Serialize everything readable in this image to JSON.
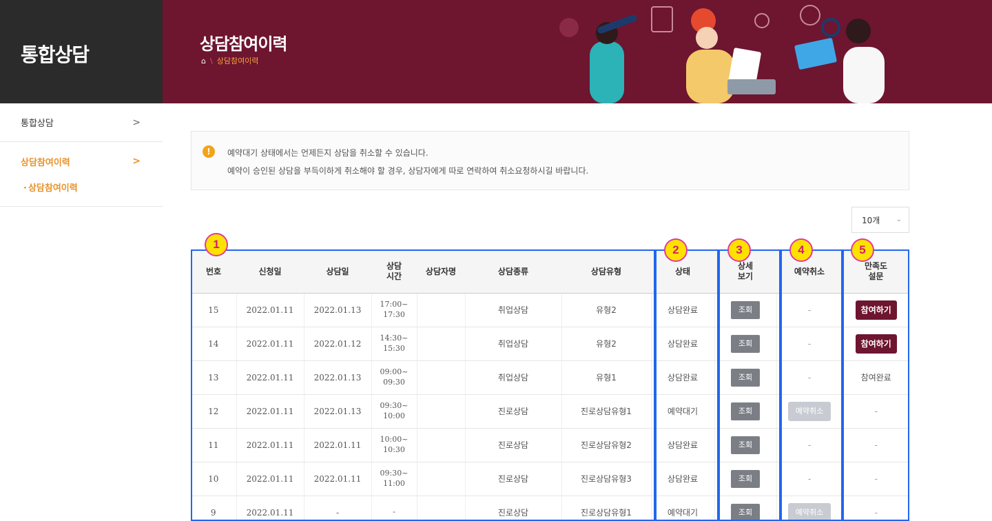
{
  "sidebar": {
    "brand": "통합상담",
    "items": [
      {
        "label": "통합상담",
        "chevron": ">"
      },
      {
        "label": "상담참여이력",
        "chevron": ">"
      }
    ],
    "sub_item": "상담참여이력"
  },
  "banner": {
    "title": "상담참여이력",
    "breadcrumb_current": "상담참여이력",
    "home_icon": "home-icon"
  },
  "notice": {
    "icon": "!",
    "line1": "예약대기 상태에서는 언제든지 상담을 취소할 수 있습니다.",
    "line2": "예약이 승인된 상담을 부득이하게 취소해야 할 경우, 상담자에게 따로 연락하여 취소요청하시길 바랍니다."
  },
  "page_size": {
    "value": "10개",
    "caret": "⌄"
  },
  "table": {
    "headers": {
      "no": "번호",
      "apply_date": "신청일",
      "counsel_date": "상담일",
      "time_l1": "상담",
      "time_l2": "시간",
      "counselor": "상담자명",
      "kind": "상담종류",
      "type": "상담유형",
      "status": "상태",
      "detail_l1": "상세",
      "detail_l2": "보기",
      "cancel": "예약취소",
      "survey_l1": "만족도",
      "survey_l2": "설문"
    },
    "rows": [
      {
        "no": "15",
        "apply": "2022.01.11",
        "date": "2022.01.13",
        "t1": "17:00~",
        "t2": "17:30",
        "counselor": "",
        "kind": "취업상담",
        "type": "유형2",
        "status": "상담완료",
        "view": "조회",
        "cancel": "-",
        "survey": "참여하기",
        "survey_mode": "button"
      },
      {
        "no": "14",
        "apply": "2022.01.11",
        "date": "2022.01.12",
        "t1": "14:30~",
        "t2": "15:30",
        "counselor": "",
        "kind": "취업상담",
        "type": "유형2",
        "status": "상담완료",
        "view": "조회",
        "cancel": "-",
        "survey": "참여하기",
        "survey_mode": "button"
      },
      {
        "no": "13",
        "apply": "2022.01.11",
        "date": "2022.01.13",
        "t1": "09:00~",
        "t2": "09:30",
        "counselor": "",
        "kind": "취업상담",
        "type": "유형1",
        "status": "상담완료",
        "view": "조회",
        "cancel": "-",
        "survey": "참여완료",
        "survey_mode": "text"
      },
      {
        "no": "12",
        "apply": "2022.01.11",
        "date": "2022.01.13",
        "t1": "09:30~",
        "t2": "10:00",
        "counselor": "",
        "kind": "진로상담",
        "type": "진로상담유형1",
        "status": "예약대기",
        "view": "조회",
        "cancel": "예약취소",
        "survey": "-",
        "survey_mode": "text"
      },
      {
        "no": "11",
        "apply": "2022.01.11",
        "date": "2022.01.11",
        "t1": "10:00~",
        "t2": "10:30",
        "counselor": "",
        "kind": "진로상담",
        "type": "진로상담유형2",
        "status": "상담완료",
        "view": "조회",
        "cancel": "-",
        "survey": "-",
        "survey_mode": "text"
      },
      {
        "no": "10",
        "apply": "2022.01.11",
        "date": "2022.01.11",
        "t1": "09:30~",
        "t2": "11:00",
        "counselor": "",
        "kind": "진로상담",
        "type": "진로상담유형3",
        "status": "상담완료",
        "view": "조회",
        "cancel": "-",
        "survey": "-",
        "survey_mode": "text"
      },
      {
        "no": "9",
        "apply": "2022.01.11",
        "date": "-",
        "t1": "-",
        "t2": "",
        "counselor": "",
        "kind": "진로상담",
        "type": "진로상담유형1",
        "status": "예약대기",
        "view": "조회",
        "cancel": "예약취소",
        "survey": "-",
        "survey_mode": "text"
      }
    ]
  },
  "annotations": [
    "1",
    "2",
    "3",
    "4",
    "5"
  ],
  "colors": {
    "brand_dark": "#2b2b2b",
    "banner": "#6e1530",
    "accent": "#e8922a",
    "highlight": "#2266ee",
    "badge": "#ffe100"
  }
}
